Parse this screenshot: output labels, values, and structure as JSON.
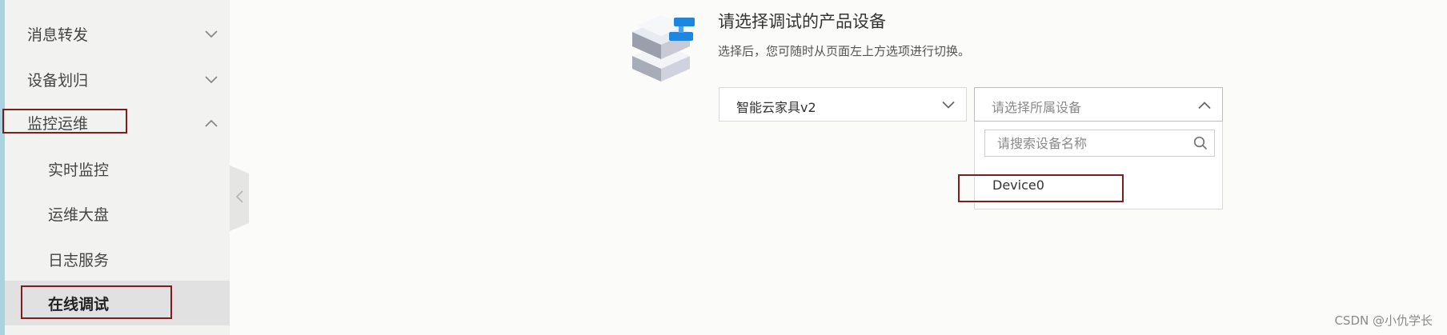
{
  "sidebar": {
    "menus": [
      {
        "label": "消息转发",
        "icon": "chevron-down-icon"
      },
      {
        "label": "设备划归",
        "icon": "chevron-down-icon"
      },
      {
        "label": "监控运维",
        "icon": "chevron-up-icon"
      }
    ],
    "subitems": [
      {
        "label": "实时监控"
      },
      {
        "label": "运维大盘"
      },
      {
        "label": "日志服务"
      },
      {
        "label": "在线调试",
        "active": true
      }
    ],
    "collapse_icon": "chevron-left-icon"
  },
  "main": {
    "title": "请选择调试的产品设备",
    "subtitle": "选择后，您可随时从页面左上方选项进行切换。",
    "illustration_icon": "device-stack-icon",
    "product_select": {
      "value": "智能云家具v2",
      "icon": "chevron-down-icon"
    },
    "device_select": {
      "placeholder": "请选择所属设备",
      "icon": "chevron-up-icon",
      "search_placeholder": "请搜索设备名称",
      "search_icon": "search-icon",
      "options": [
        "Device0"
      ]
    }
  },
  "watermark": "CSDN @小仇学长",
  "colors": {
    "highlight": "#7d1d1d",
    "sidebar_bg": "#f2f2f1",
    "active_bg": "#e1e1e1",
    "accent": "#1f86e0"
  }
}
